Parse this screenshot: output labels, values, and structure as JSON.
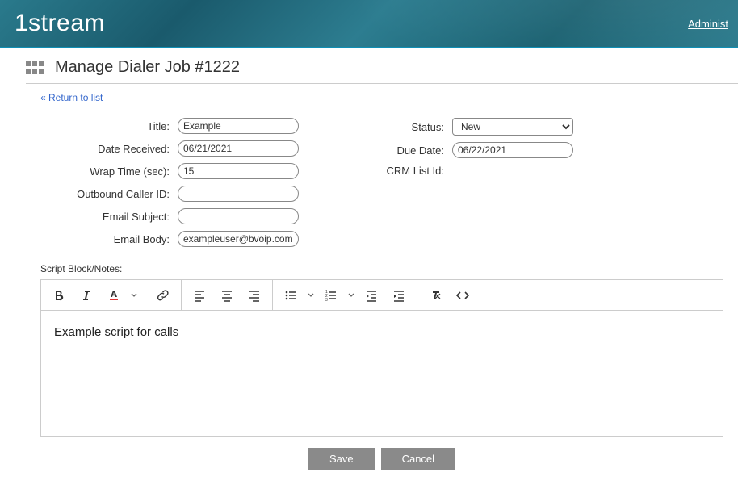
{
  "header": {
    "logo_text": "1stream",
    "admin_link": "Administ"
  },
  "page": {
    "title": "Manage Dialer Job #1222",
    "return_link": "« Return to list"
  },
  "form": {
    "left": {
      "title": {
        "label": "Title:",
        "value": "Example"
      },
      "date_received": {
        "label": "Date Received:",
        "value": "06/21/2021"
      },
      "wrap_time": {
        "label": "Wrap Time (sec):",
        "value": "15"
      },
      "outbound_caller": {
        "label": "Outbound Caller ID:",
        "value": ""
      },
      "email_subject": {
        "label": "Email Subject:",
        "value": ""
      },
      "email_body": {
        "label": "Email Body:",
        "value": "exampleuser@bvoip.com"
      }
    },
    "right": {
      "status": {
        "label": "Status:",
        "value": "New",
        "options": [
          "New"
        ]
      },
      "due_date": {
        "label": "Due Date:",
        "value": "06/22/2021"
      },
      "crm_list": {
        "label": "CRM List Id:",
        "value": ""
      }
    }
  },
  "editor": {
    "label": "Script Block/Notes:",
    "content": "Example script for calls"
  },
  "buttons": {
    "save": "Save",
    "cancel": "Cancel"
  }
}
